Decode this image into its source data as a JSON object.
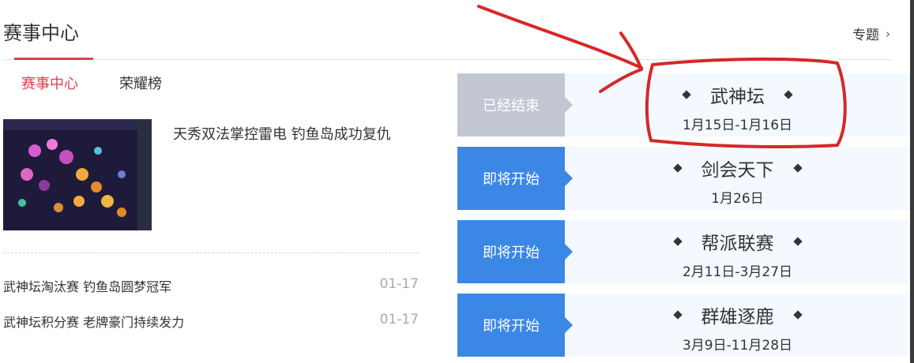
{
  "header": {
    "title": "赛事中心",
    "topic_link": "专题"
  },
  "tabs": [
    {
      "label": "赛事中心",
      "active": true
    },
    {
      "label": "荣耀榜",
      "active": false
    }
  ],
  "feature": {
    "title": "天秀双法掌控雷电 钓鱼岛成功复仇"
  },
  "news": [
    {
      "title": "武神坛淘汰赛 钓鱼岛圆梦冠军",
      "date": "01-17"
    },
    {
      "title": "武神坛积分赛 老牌豪门持续发力",
      "date": "01-17"
    }
  ],
  "events": [
    {
      "status": "已经结束",
      "state": "ended",
      "name": "武神坛",
      "dates": "1月15日-1月16日"
    },
    {
      "status": "即将开始",
      "state": "upcoming",
      "name": "剑会天下",
      "dates": "1月26日"
    },
    {
      "status": "即将开始",
      "state": "upcoming",
      "name": "帮派联赛",
      "dates": "2月11日-3月27日"
    },
    {
      "status": "即将开始",
      "state": "upcoming",
      "name": "群雄逐鹿",
      "dates": "3月9日-11月28日"
    }
  ],
  "colors": {
    "accent": "#e0404f",
    "upcoming": "#3b87e6",
    "ended": "#c2c7d3",
    "annotation": "#d62828"
  },
  "icons": {
    "topic_chevron": "chevron-right-icon",
    "event_marker": "diamond-icon"
  }
}
